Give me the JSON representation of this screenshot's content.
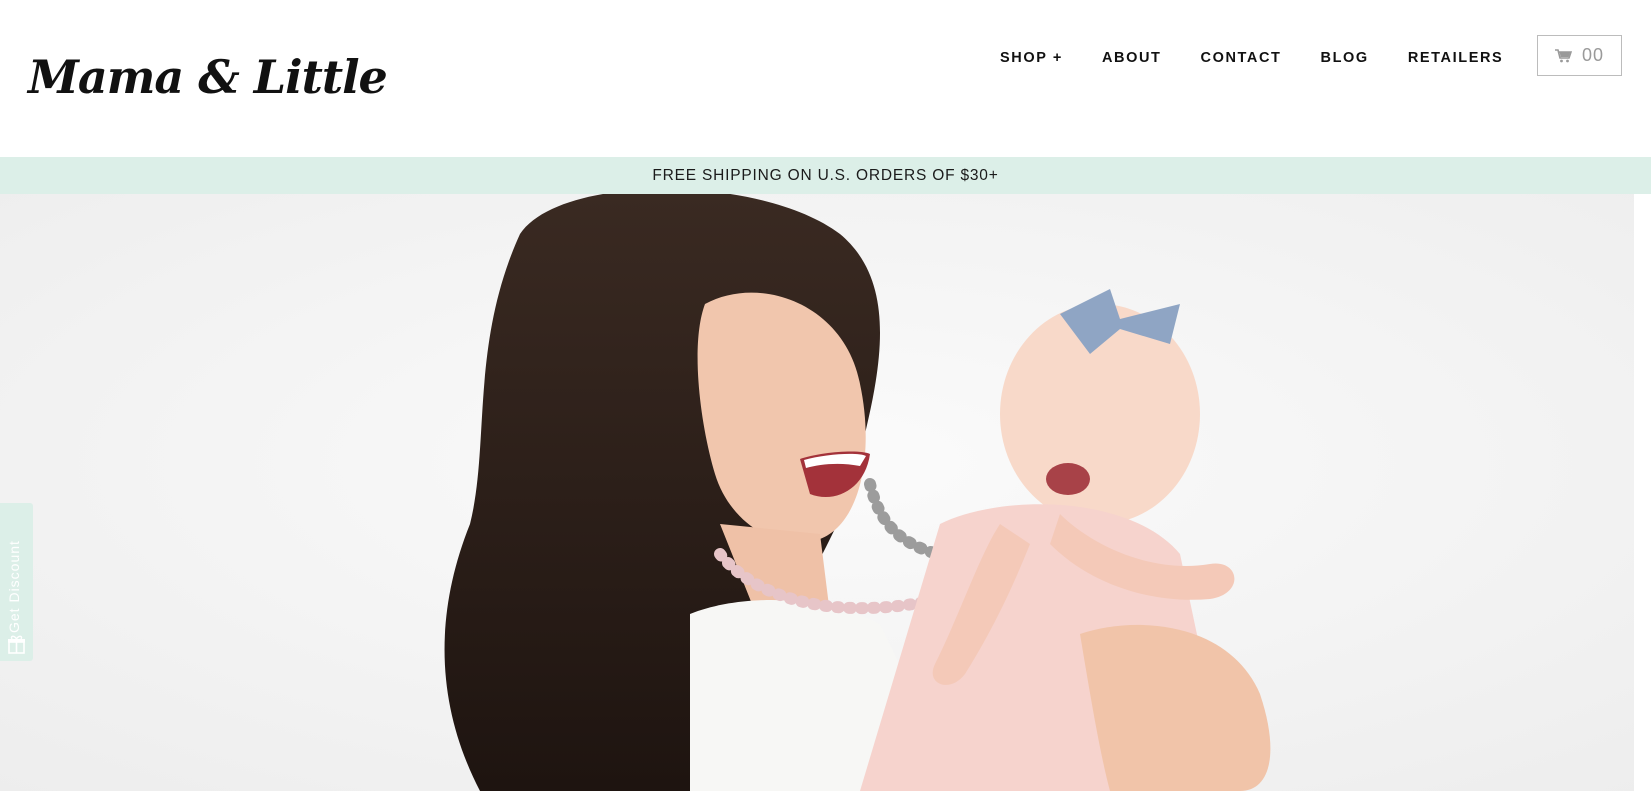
{
  "brand": {
    "logo_text": "Mama & Little"
  },
  "nav": {
    "items": [
      {
        "label": "SHOP +"
      },
      {
        "label": "ABOUT"
      },
      {
        "label": "CONTACT"
      },
      {
        "label": "BLOG"
      },
      {
        "label": "RETAILERS"
      }
    ]
  },
  "cart": {
    "count": "00",
    "icon": "cart-icon"
  },
  "promo": {
    "text": "FREE SHIPPING ON U.S. ORDERS OF $30+"
  },
  "discount_tab": {
    "label": "Get Discount",
    "icon": "gift-icon"
  },
  "colors": {
    "promo_bg": "#dcefe8",
    "text": "#111111",
    "cart_text": "#9a9a9a"
  }
}
